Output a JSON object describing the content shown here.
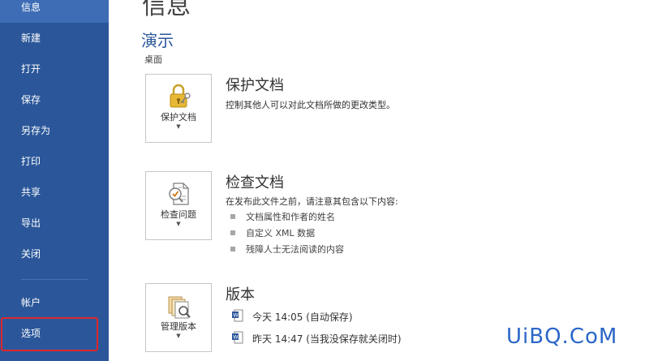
{
  "sidebar": {
    "items": [
      {
        "label": "信息"
      },
      {
        "label": "新建"
      },
      {
        "label": "打开"
      },
      {
        "label": "保存"
      },
      {
        "label": "另存为"
      },
      {
        "label": "打印"
      },
      {
        "label": "共享"
      },
      {
        "label": "导出"
      },
      {
        "label": "关闭"
      },
      {
        "label": "帐户"
      },
      {
        "label": "选项"
      }
    ]
  },
  "main": {
    "title": "信息",
    "doc_name": "演示",
    "doc_location": "桌面",
    "protect": {
      "tile_label": "保护文档",
      "title": "保护文档",
      "desc": "控制其他人可以对此文档所做的更改类型。"
    },
    "inspect": {
      "tile_label": "检查问题",
      "title": "检查文档",
      "desc": "在发布此文件之前，请注意其包含以下内容:",
      "bullets": [
        "文档属性和作者的姓名",
        "自定义 XML 数据",
        "残障人士无法阅读的内容"
      ]
    },
    "versions": {
      "tile_label": "管理版本",
      "title": "版本",
      "items": [
        "今天 14:05 (自动保存)",
        "昨天 14:47 (当我没保存就关闭时)"
      ]
    }
  },
  "watermark": "UiBQ.CoM",
  "colors": {
    "sidebar": "#2b579a",
    "active": "#3e6db5",
    "highlight": "#e0262a",
    "accent": "#2b579a"
  }
}
